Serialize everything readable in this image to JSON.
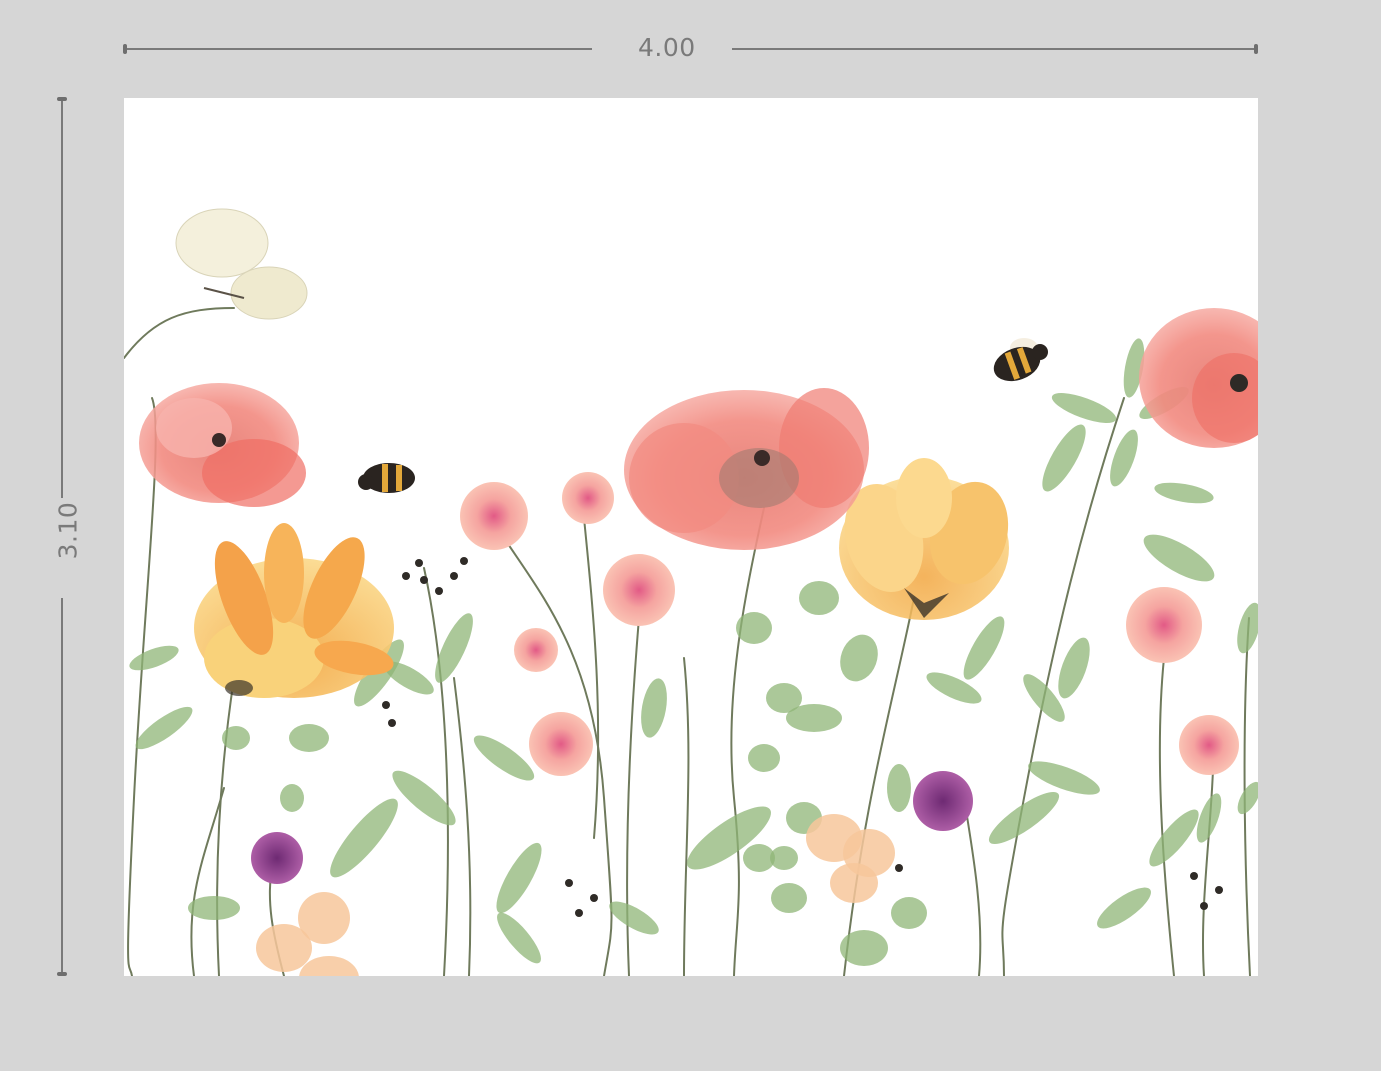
{
  "dimensions": {
    "width_label": "4.00",
    "height_label": "3.10"
  },
  "artwork": {
    "theme": "watercolor wildflower meadow",
    "background": "#ffffff",
    "palette": {
      "poppy": "#f07a72",
      "sunflower": "#f6a545",
      "yellow": "#f6c15e",
      "pink": "#f3a0a0",
      "purple": "#8e3c8a",
      "leaf": "#8fb577",
      "stem": "#6f7a5c",
      "bee": "#2a2420",
      "butterfly": "#f4f0dc"
    }
  }
}
